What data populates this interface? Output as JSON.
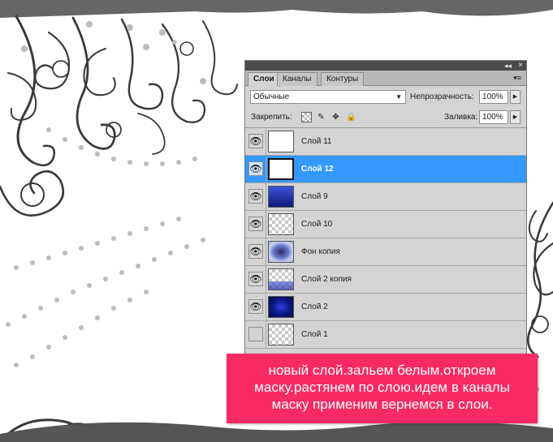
{
  "panel": {
    "collapse_icon": "collapse-icon",
    "close_icon": "close-icon",
    "tabs": [
      {
        "label": "Слои",
        "active": true
      },
      {
        "label": "Каналы",
        "active": false
      },
      {
        "label": "Контуры",
        "active": false
      }
    ],
    "blend_mode": "Обычные",
    "opacity_label": "Непрозрачность:",
    "opacity_value": "100%",
    "lock_label": "Закрепить:",
    "fill_label": "Заливка:",
    "fill_value": "100%"
  },
  "layers": [
    {
      "name": "Слой 11",
      "visible": true,
      "selected": false
    },
    {
      "name": "Слой 12",
      "visible": true,
      "selected": true
    },
    {
      "name": "Слой 9",
      "visible": true,
      "selected": false
    },
    {
      "name": "Слой 10",
      "visible": true,
      "selected": false
    },
    {
      "name": "Фон копия",
      "visible": true,
      "selected": false
    },
    {
      "name": "Слой 2 копия",
      "visible": true,
      "selected": false
    },
    {
      "name": "Слой 2",
      "visible": true,
      "selected": false
    },
    {
      "name": "Слой 1",
      "visible": false,
      "selected": false
    }
  ],
  "caption": {
    "line1": "новый слой.зальем белым.откроем",
    "line2": "маску.растянем по слою.идем в каналы",
    "line3": "маску применим вернемся в слои."
  },
  "colors": {
    "selection": "#3399ff",
    "caption_bg": "#f72a64",
    "panel_bg": "#d4d4d4",
    "swirl": "#3a3a3a"
  }
}
